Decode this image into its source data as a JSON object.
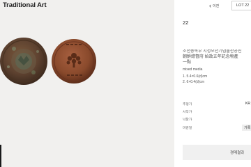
{
  "header": {
    "category_title": "Traditional Art",
    "prev_label": "이전",
    "lot_label": "LOT 22"
  },
  "lot": {
    "number": "22",
    "title_lines": [
      "조선총독부 시정오년기념물산공진",
      "朝鮮總督府 始政五年記念物產",
      "一點"
    ],
    "medium": "mixed media",
    "size_1": "1. 5.4×0.6(d)cm",
    "size_2": "2. 6×0.4(d)cm"
  },
  "info": {
    "estimate_label": "추정가",
    "estimate_value": "KR",
    "start_label": "시작가",
    "hammer_label": "낙찰가",
    "deadline_label": "마감일",
    "deadline_value": "기록"
  },
  "result_button": "경매결과",
  "icons": {
    "prev": "chevron-left-icon"
  },
  "colors": {
    "left_bg": "#f1f0ee",
    "coin_bronze": "#7a4a2a",
    "coin_copper": "#8a4a2c"
  }
}
